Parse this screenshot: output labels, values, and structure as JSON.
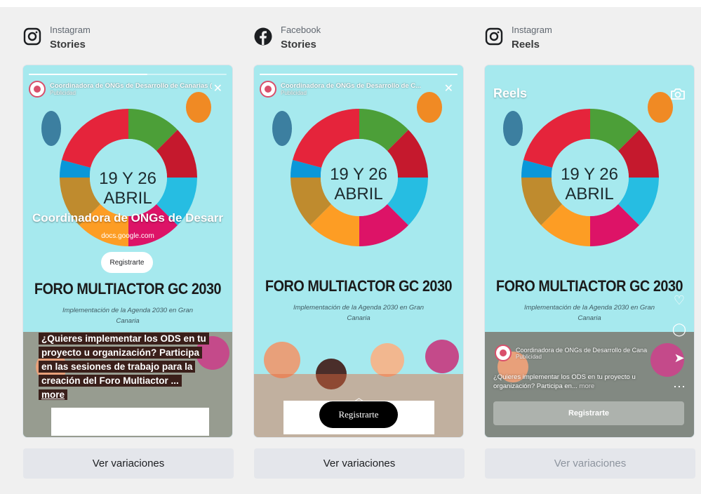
{
  "placements": [
    {
      "platform": "Instagram",
      "placement": "Stories",
      "icon": "instagram-icon",
      "variations_button": "Ver variaciones",
      "ad": {
        "advertiser": "Coordinadora de ONGs de Desarrollo de Canarias (",
        "sponsored": "Publicidad",
        "overlay_title": "Coordinadora de ONGs de Desarr",
        "domain": "docs.google.com",
        "cta": "Registrarte",
        "caption_lines": [
          "¿Quieres implementar los ODS en tu",
          "proyecto u organización? Participa",
          "en las sesiones de trabajo para la",
          "creación del Foro Multiactor ..."
        ],
        "more": "more",
        "progress": 0.6
      }
    },
    {
      "platform": "Facebook",
      "placement": "Stories",
      "icon": "facebook-icon",
      "variations_button": "Ver variaciones",
      "ad": {
        "advertiser": "Coordinadora de ONGs de Desarrollo de C...",
        "sponsored": "Publicidad",
        "cta": "Registrarte",
        "progress": 1.0
      }
    },
    {
      "platform": "Instagram",
      "placement": "Reels",
      "icon": "instagram-icon",
      "variations_button": "Ver variaciones",
      "variations_disabled": true,
      "ad": {
        "reels_label": "Reels",
        "advertiser": "Coordinadora de ONGs de Desarrollo de Cana",
        "sponsored": "Publicidad",
        "caption": "¿Quieres implementar los ODS en tu proyecto u organización? Participa en...",
        "more": "more",
        "cta": "Registrarte"
      }
    }
  ],
  "creative": {
    "date_line1": "19 Y 26",
    "date_line2": "ABRIL",
    "headline": "FORO MULTIACTOR GC 2030",
    "subline1": "Implementación de la Agenda 2030 en Gran",
    "subline2": "Canaria",
    "org_logo": "CONGDCA"
  },
  "colors": {
    "page_bg": "#f0f0f0",
    "poster_bg": "#a6e9ee",
    "button_bg": "#e4e6eb",
    "caption_bg": "#3a1f1a"
  }
}
